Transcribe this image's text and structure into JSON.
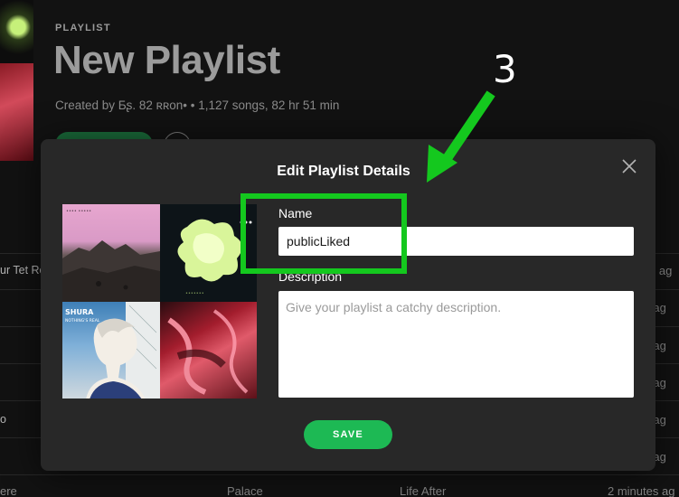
{
  "background": {
    "label": "PLAYLIST",
    "title": "New Playlist",
    "meta": "Created by Ƃʂ. 82 ʀʀon• • 1,127 songs, 82 hr 51 min",
    "rows_left": [
      "ur Tet Ro",
      "",
      "",
      "",
      "o",
      "",
      ""
    ],
    "rows_right": [
      "ites ag",
      "es ag",
      "es ag",
      "es ag",
      "es ag",
      "es ag",
      "es ag"
    ],
    "bottom": {
      "track": "ere",
      "artist": "Palace",
      "album": "Life After",
      "added": "2 minutes ag"
    }
  },
  "modal": {
    "title": "Edit Playlist Details",
    "name_label": "Name",
    "name_value": "publicLiked",
    "description_label": "Description",
    "description_placeholder": "Give your playlist a catchy description.",
    "save_label": "SAVE",
    "cover_art_text": {
      "q1": "•••• •••••",
      "q2": "•••••••",
      "q3_artist": "SHURA",
      "q3_subtitle": "NOTHING'S REAL"
    }
  },
  "annotation": {
    "number": "3",
    "color": "#14c81e"
  },
  "colors": {
    "accent": "#1db954",
    "modal_bg": "#282828",
    "page_bg": "#121212"
  }
}
